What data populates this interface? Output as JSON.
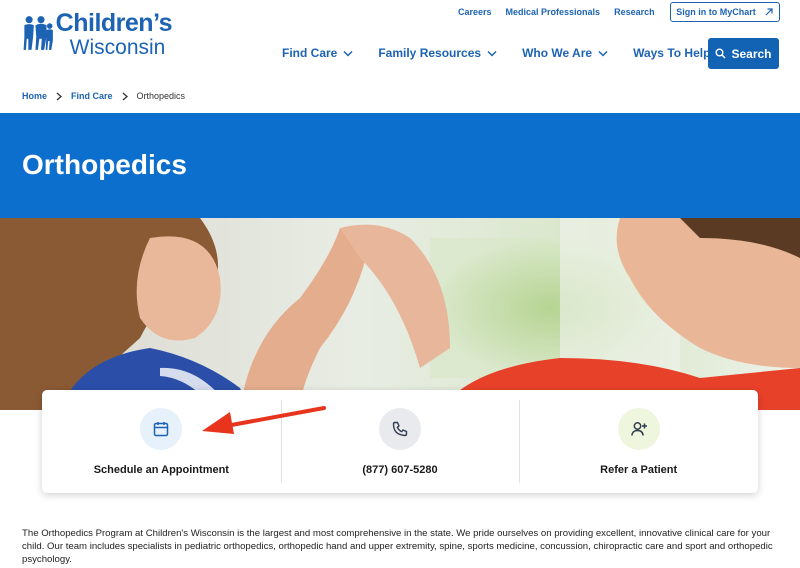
{
  "logo": {
    "line1": "Children’s",
    "line2": "Wisconsin"
  },
  "util_nav": [
    "Careers",
    "Medical Professionals",
    "Research"
  ],
  "mychart": {
    "label": "Sign in to MyChart"
  },
  "main_nav": [
    "Find Care",
    "Family Resources",
    "Who We Are",
    "Ways To Help"
  ],
  "search": {
    "label": "Search"
  },
  "breadcrumb": {
    "home": "Home",
    "parent": "Find Care",
    "current": "Orthopedics"
  },
  "hero": {
    "title": "Orthopedics"
  },
  "actions": [
    {
      "label": "Schedule an Appointment",
      "icon": "calendar-icon",
      "bg": "#e6f1fb",
      "color": "#1d63b4"
    },
    {
      "label": "(877) 607-5280",
      "icon": "phone-icon",
      "bg": "#e9eaee",
      "color": "#2f3b4e"
    },
    {
      "label": "Refer a Patient",
      "icon": "add-user-icon",
      "bg": "#eef6dd",
      "color": "#2f3b4e"
    }
  ],
  "intro": "The Orthopedics Program at Children's Wisconsin is the largest and most comprehensive in the state. We pride ourselves on providing excellent, innovative clinical care for your child. Our team includes specialists in pediatric orthopedics, orthopedic hand and upper extremity, spine, sports medicine, concussion, chiropractic care and sport and orthopedic psychology.",
  "colors": {
    "brand": "#1d63b4",
    "hero": "#0c6fcd",
    "annotation": "#e8341c"
  }
}
